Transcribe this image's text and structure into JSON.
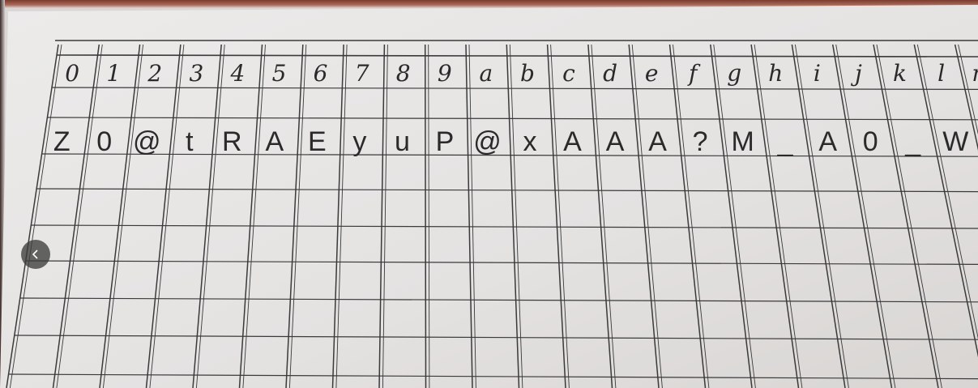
{
  "sheet": {
    "row1": [
      "0",
      "1",
      "2",
      "3",
      "4",
      "5",
      "6",
      "7",
      "8",
      "9",
      "a",
      "b",
      "c",
      "d",
      "e",
      "f",
      "g",
      "h",
      "i",
      "j",
      "k",
      "l",
      "m"
    ],
    "row2": [
      "Z",
      "0",
      "@",
      "t",
      "R",
      "A",
      "E",
      "y",
      "u",
      "P",
      "@",
      "x",
      "A",
      "A",
      "A",
      "?",
      "M",
      "_",
      "A",
      "0",
      "_",
      "W"
    ]
  },
  "nav": {
    "back_icon": "chevron-left-icon"
  },
  "colors": {
    "paper": "#e8e6e5",
    "ink": "#2a2a2a",
    "grid": "#3a3a3a"
  }
}
